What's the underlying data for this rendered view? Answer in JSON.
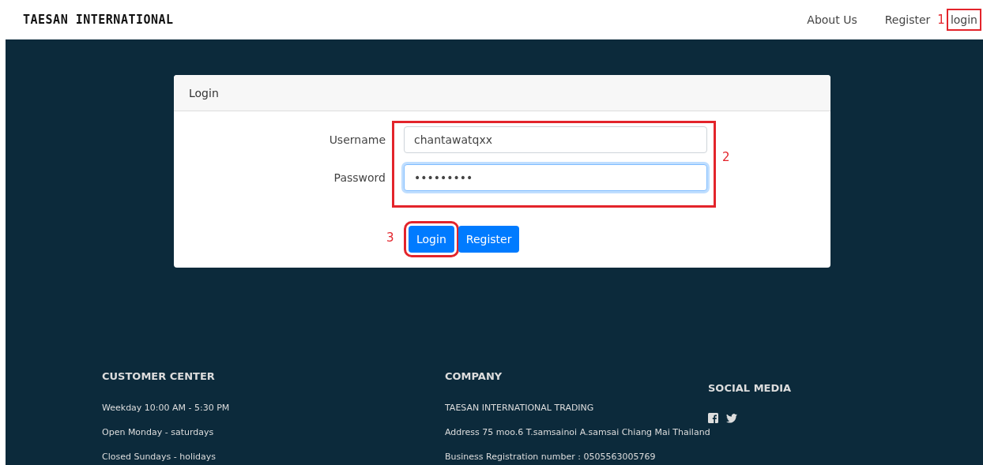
{
  "brand": "TAESAN INTERNATIONAL",
  "nav": [
    {
      "label": "About Us",
      "highlighted": false
    },
    {
      "label": "Register",
      "highlighted": false
    },
    {
      "label": "login",
      "highlighted": true,
      "marker": "1"
    }
  ],
  "login_card": {
    "title": "Login",
    "fields_highlighted": true,
    "fields_marker": "2",
    "fields": [
      {
        "label": "Username",
        "value": "chantawatqxx",
        "focused": false
      },
      {
        "label": "Password",
        "value": "•••••••••",
        "focused": true
      }
    ],
    "buttons": [
      {
        "label": "Login",
        "highlighted": true,
        "marker": "3"
      },
      {
        "label": "Register",
        "highlighted": false
      }
    ]
  },
  "footer": {
    "columns": [
      {
        "heading": "CUSTOMER CENTER",
        "lines": [
          "Weekday 10:00 AM - 5:30 PM",
          "Open Monday - saturdays",
          "Closed Sundays - holidays"
        ]
      },
      {
        "heading": "COMPANY",
        "lines": [
          "TAESAN INTERNATIONAL TRADING",
          "Address 75 moo.6 T.samsainoi A.samsai Chiang Mai Thailand",
          "Business Registration number : 0505563005769"
        ]
      }
    ],
    "social": {
      "heading": "SOCIAL MEDIA",
      "icons": [
        {
          "kind": "facebook"
        },
        {
          "kind": "twitter"
        }
      ]
    }
  }
}
